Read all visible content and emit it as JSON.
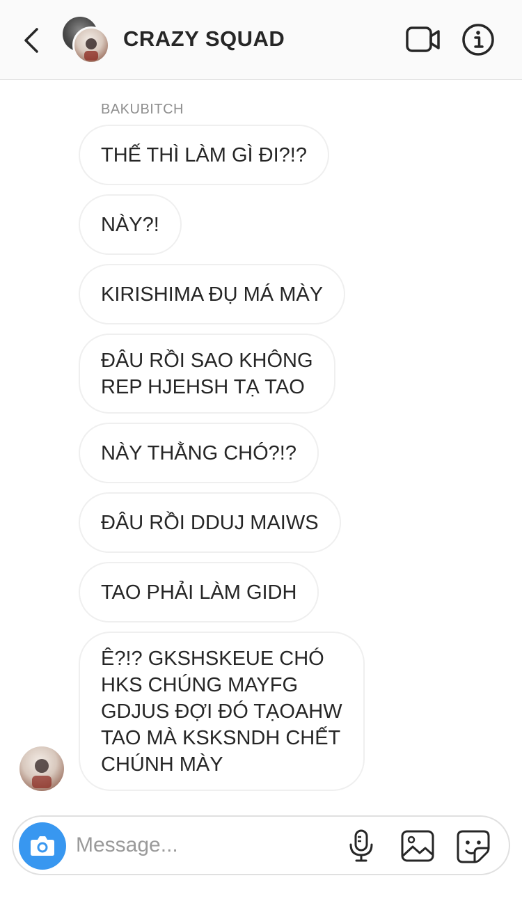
{
  "header": {
    "title": "CRAZY SQUAD",
    "back_icon": "chevron-left-icon",
    "video_icon": "video-camera-icon",
    "info_icon": "info-icon"
  },
  "thread": {
    "sender_name": "BAKUBITCH",
    "messages": [
      {
        "text": "THẾ THÌ LÀM GÌ ĐI?!?"
      },
      {
        "text": "NÀY?!"
      },
      {
        "text": "KIRISHIMA ĐỤ MÁ MÀY"
      },
      {
        "text": "ĐÂU RỒI SAO KHÔNG\nREP HJEHSH TẠ TAO"
      },
      {
        "text": "NÀY THẰNG CHÓ?!?"
      },
      {
        "text": "ĐÂU RỒI DDUJ MAIWS"
      },
      {
        "text": "TAO PHẢI LÀM GIDH"
      },
      {
        "text": "Ê?!? GKSHSKEUE CHÓ\nHKS CHÚNG MAYFG\nGDJUS ĐỢI ĐÓ TẠOAHW\nTAO MÀ KSKSNDH CHẾT\nCHÚNH MÀY"
      }
    ]
  },
  "composer": {
    "placeholder": "Message...",
    "camera_icon": "camera-icon",
    "mic_icon": "microphone-icon",
    "gallery_icon": "gallery-icon",
    "sticker_icon": "sticker-icon",
    "accent_color": "#3897f0"
  }
}
